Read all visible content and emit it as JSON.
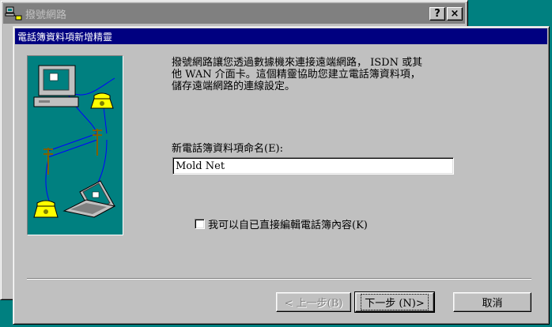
{
  "background_window": {
    "title": "撥號網路",
    "help_button": "?",
    "close_button": "×"
  },
  "wizard": {
    "title": "電話簿資料項新增精靈",
    "intro_text": "撥號網路讓您透過數據機來連接遠端網路， ISDN 或其\n他 WAN 介面卡。這個精靈協助您建立電話簿資料項，\n儲存遠端網路的連線設定。",
    "name_label": "新電話簿資料項命名(E):",
    "name_value": "Mold Net",
    "checkbox_label": "我可以自已直接編輯電話簿內容(K)",
    "checkbox_checked": false,
    "back_button": "< 上一步(B)",
    "next_button": "下一步 (N)>",
    "cancel_button": "取消"
  },
  "colors": {
    "desktop": "#008080",
    "active_titlebar": "#000080",
    "inactive_titlebar": "#808080",
    "face": "#c0c0c0"
  }
}
